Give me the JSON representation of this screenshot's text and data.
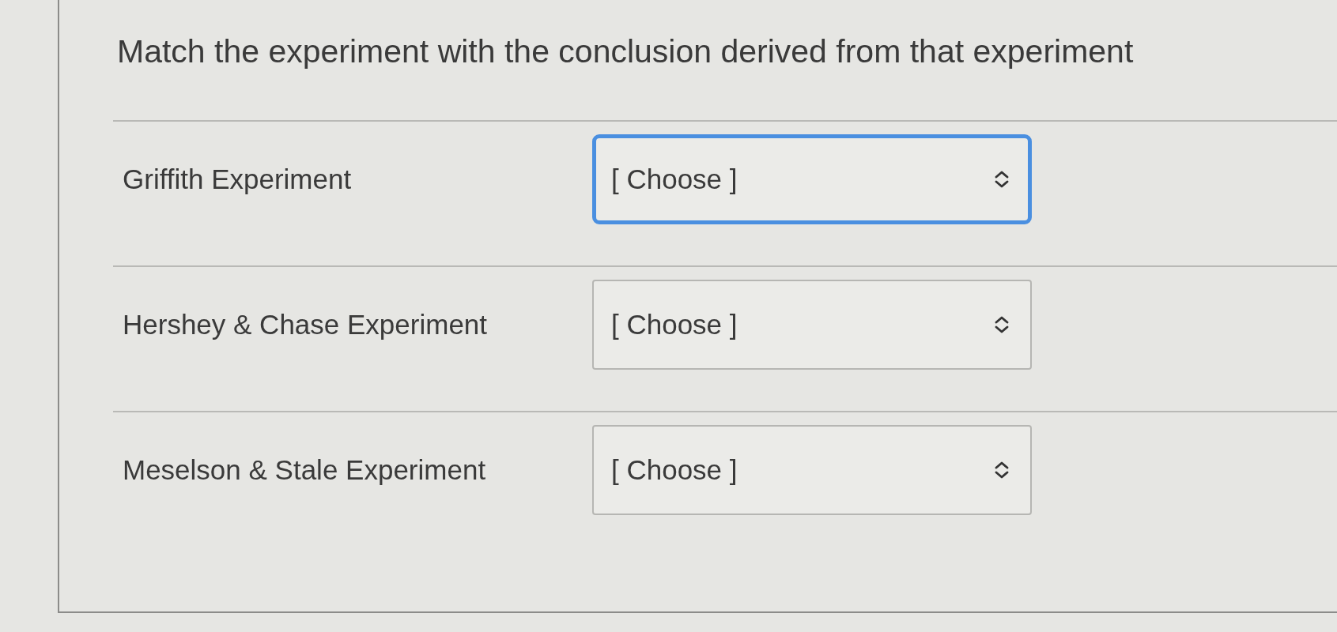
{
  "question": {
    "prompt": "Match the experiment with the conclusion derived from that experiment"
  },
  "rows": [
    {
      "label": "Griffith Experiment",
      "select": {
        "value": "[ Choose ]",
        "focused": true
      }
    },
    {
      "label": "Hershey & Chase Experiment",
      "select": {
        "value": "[ Choose ]",
        "focused": false
      }
    },
    {
      "label": "Meselson & Stale Experiment",
      "select": {
        "value": "[ Choose ]",
        "focused": false
      }
    }
  ]
}
